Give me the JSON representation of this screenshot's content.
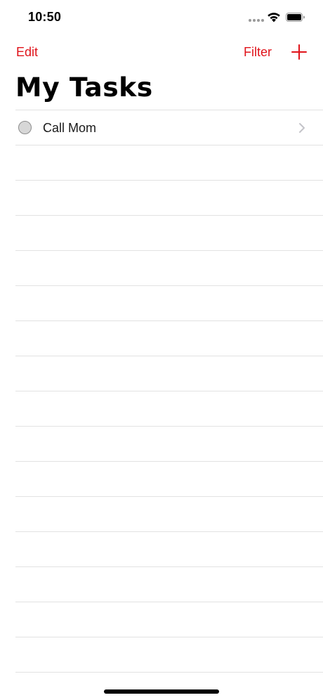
{
  "status_bar": {
    "time": "10:50"
  },
  "nav": {
    "edit_label": "Edit",
    "filter_label": "Filter",
    "add_icon": "plus-icon"
  },
  "title": "My Tasks",
  "tasks": [
    {
      "title": "Call Mom",
      "completed": false
    }
  ],
  "colors": {
    "accent": "#e0131a",
    "separator": "#e2e2e2",
    "checkbox_fill": "#d7d7d7"
  }
}
